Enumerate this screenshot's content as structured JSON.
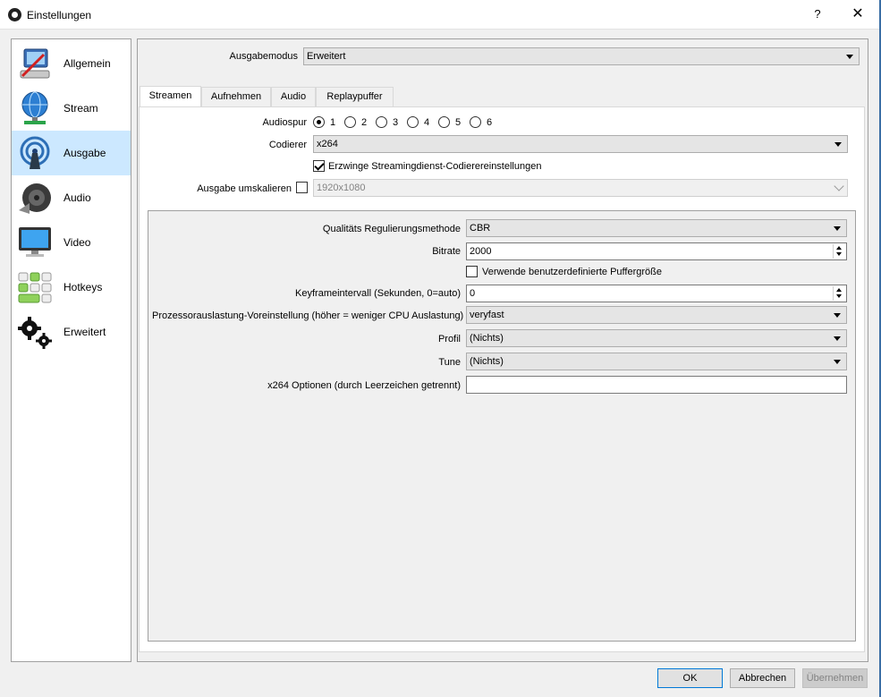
{
  "window": {
    "title": "Einstellungen",
    "help_label": "?",
    "close_label": "✕"
  },
  "sidebar": {
    "items": [
      {
        "label": "Allgemein",
        "icon": "general-computer-icon",
        "active": false
      },
      {
        "label": "Stream",
        "icon": "stream-globe-icon",
        "active": false
      },
      {
        "label": "Ausgabe",
        "icon": "output-broadcast-icon",
        "active": true
      },
      {
        "label": "Audio",
        "icon": "speaker-icon",
        "active": false
      },
      {
        "label": "Video",
        "icon": "monitor-icon",
        "active": false
      },
      {
        "label": "Hotkeys",
        "icon": "keyboard-icon",
        "active": false
      },
      {
        "label": "Erweitert",
        "icon": "gears-icon",
        "active": false
      }
    ]
  },
  "output_mode": {
    "label": "Ausgabemodus",
    "value": "Erweitert"
  },
  "tabs": [
    {
      "label": "Streamen",
      "active": true
    },
    {
      "label": "Aufnehmen",
      "active": false
    },
    {
      "label": "Audio",
      "active": false
    },
    {
      "label": "Replaypuffer",
      "active": false
    }
  ],
  "stream": {
    "audio_track": {
      "label": "Audiospur",
      "options": [
        "1",
        "2",
        "3",
        "4",
        "5",
        "6"
      ],
      "selected": "1"
    },
    "encoder": {
      "label": "Codierer",
      "value": "x264"
    },
    "enforce": {
      "label": "Erzwinge Streamingdienst-Codierereinstellungen",
      "checked": true
    },
    "rescale": {
      "label": "Ausgabe umskalieren",
      "checked": false,
      "value": "1920x1080"
    }
  },
  "encoder_settings": {
    "rate_control": {
      "label": "Qualitäts Regulierungsmethode",
      "value": "CBR"
    },
    "bitrate": {
      "label": "Bitrate",
      "value": "2000"
    },
    "custom_buffer": {
      "label": "Verwende benutzerdefinierte Puffergröße",
      "checked": false
    },
    "keyframe": {
      "label": "Keyframeintervall (Sekunden, 0=auto)",
      "value": "0"
    },
    "preset": {
      "label": "Prozessorauslastung-Voreinstellung (höher = weniger CPU Auslastung)",
      "value": "veryfast"
    },
    "profile": {
      "label": "Profil",
      "value": "(Nichts)"
    },
    "tune": {
      "label": "Tune",
      "value": "(Nichts)"
    },
    "x264opts": {
      "label": "x264 Optionen (durch Leerzeichen getrennt)",
      "value": ""
    }
  },
  "buttons": {
    "ok": "OK",
    "cancel": "Abbrechen",
    "apply": "Übernehmen"
  }
}
